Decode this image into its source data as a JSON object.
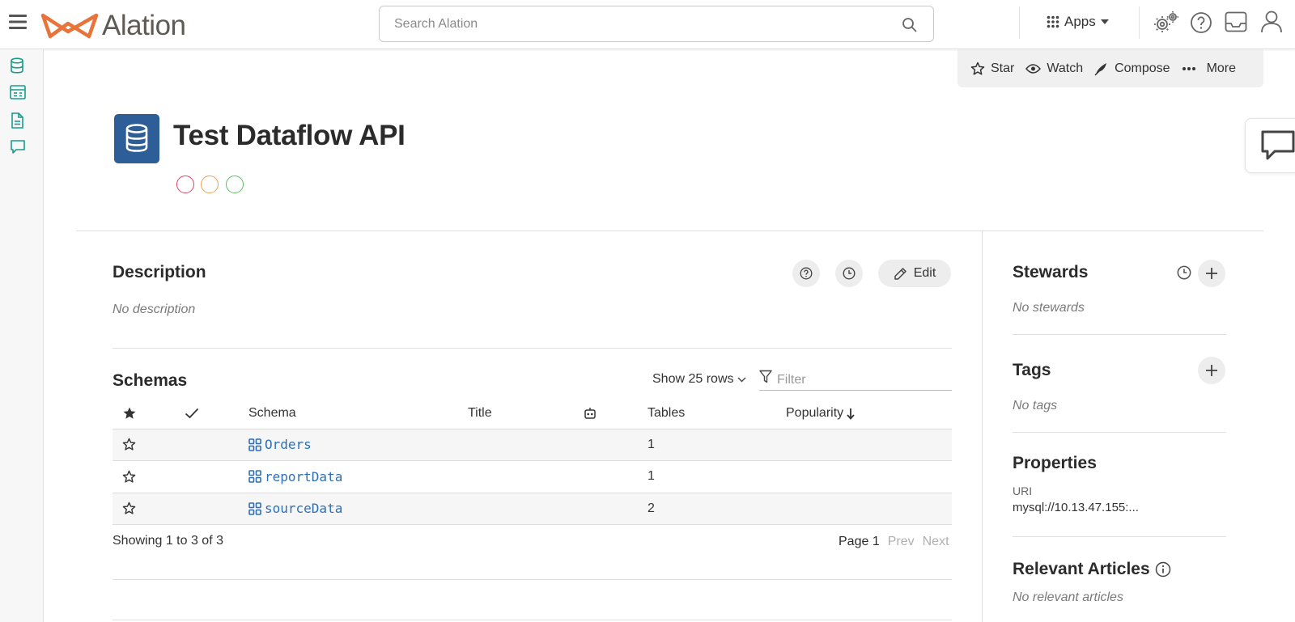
{
  "app": {
    "name": "Alation"
  },
  "colors": {
    "brand_orange": "#e8743b",
    "object_blue": "#2e5e97",
    "link_blue": "#2d6fb7",
    "trust_red": "#e0405e",
    "trust_orange": "#f0a050",
    "trust_green": "#5cc05c",
    "rail_teal": "#1a9c8c"
  },
  "header": {
    "search_placeholder": "Search Alation",
    "apps_label": "Apps",
    "icons": [
      "menu-icon",
      "search-icon",
      "apps-grid-icon",
      "settings-gears-icon",
      "help-icon",
      "inbox-icon",
      "user-icon"
    ]
  },
  "leftrail": {
    "icons": [
      "database-icon",
      "table-icon",
      "document-icon",
      "conversation-icon"
    ]
  },
  "actions": {
    "star": "Star",
    "watch": "Watch",
    "compose": "Compose",
    "more": "More"
  },
  "object": {
    "title": "Test Dataflow API",
    "icon": "database-icon",
    "trust_flags": [
      "deprecation",
      "warning",
      "endorsement"
    ]
  },
  "description": {
    "heading": "Description",
    "empty": "No description",
    "edit_label": "Edit"
  },
  "schemas": {
    "heading": "Schemas",
    "show_rows": "Show 25 rows",
    "filter_placeholder": "Filter",
    "columns": {
      "schema": "Schema",
      "title": "Title",
      "tables": "Tables",
      "popularity": "Popularity"
    },
    "rows": [
      {
        "schema": "Orders",
        "title": "",
        "tables": "1"
      },
      {
        "schema": "reportData",
        "title": "",
        "tables": "1"
      },
      {
        "schema": "sourceData",
        "title": "",
        "tables": "2"
      }
    ],
    "showing": "Showing 1 to 3 of 3",
    "page_label": "Page 1",
    "prev": "Prev",
    "next": "Next"
  },
  "sidebar": {
    "stewards": {
      "heading": "Stewards",
      "empty": "No stewards"
    },
    "tags": {
      "heading": "Tags",
      "empty": "No tags"
    },
    "properties": {
      "heading": "Properties",
      "uri_label": "URI",
      "uri_value": "mysql://10.13.47.155:..."
    },
    "relevant_articles": {
      "heading": "Relevant Articles",
      "empty": "No relevant articles"
    }
  }
}
